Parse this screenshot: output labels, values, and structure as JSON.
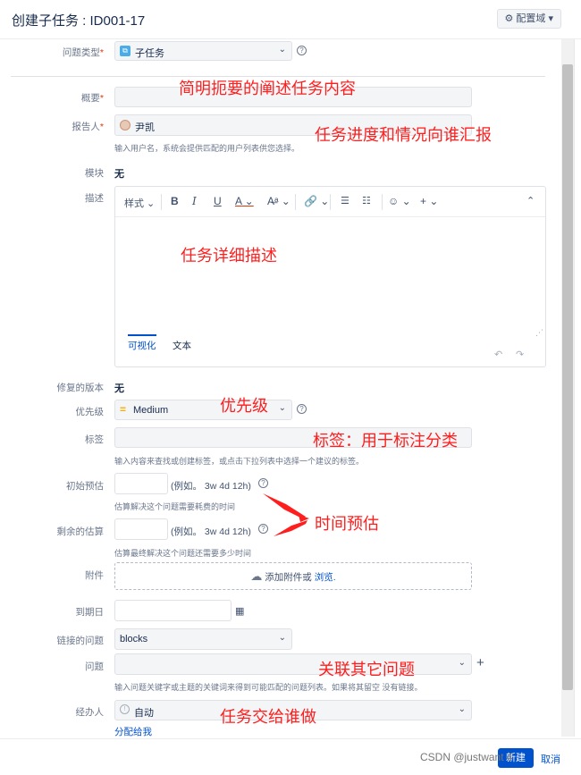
{
  "header": {
    "title": "创建子任务 : ID001-17",
    "config_label": "配置域"
  },
  "form": {
    "issue_type": {
      "label": "问题类型",
      "value": "子任务"
    },
    "summary": {
      "label": "概要",
      "value": ""
    },
    "reporter": {
      "label": "报告人",
      "value": "尹凯",
      "hint": "输入用户名，系统会提供匹配的用户列表供您选择。"
    },
    "module": {
      "label": "模块",
      "value": "无"
    },
    "description": {
      "label": "描述",
      "toolbar": {
        "style_label": "样式",
        "bold": "B",
        "italic": "I",
        "underline": "U",
        "text_color": "A"
      },
      "tabs": [
        "可视化",
        "文本"
      ]
    },
    "fix_version": {
      "label": "修复的版本",
      "value": "无"
    },
    "priority": {
      "label": "优先级",
      "value": "Medium"
    },
    "labels": {
      "label": "标签",
      "value": "",
      "hint": "输入内容来查找或创建标签，或点击下拉列表中选择一个建议的标签。"
    },
    "original_estimate": {
      "label": "初始预估",
      "example": "(例如。 3w 4d 12h)",
      "hint": "估算解决这个问题需要耗费的时间"
    },
    "remaining_estimate": {
      "label": "剩余的估算",
      "example": "(例如。 3w 4d 12h)",
      "hint": "估算最终解决这个问题还需要多少时间"
    },
    "attachment": {
      "label": "附件",
      "text": "添加附件或",
      "browse": "浏览."
    },
    "due_date": {
      "label": "到期日",
      "value": ""
    },
    "linked_issues": {
      "label": "链接的问题",
      "value": "blocks"
    },
    "issue": {
      "label": "问题",
      "value": "",
      "hint": "输入问题关键字或主题的关键词来得到可能匹配的问题列表。如果将其留空 没有链接。"
    },
    "assignee": {
      "label": "经办人",
      "value": "自动",
      "assign_to_me": "分配给我"
    }
  },
  "annotations": {
    "summary": "简明扼要的阐述任务内容",
    "reporter": "任务进度和情况向谁汇报",
    "description": "任务详细描述",
    "priority": "优先级",
    "labels": "标签：用于标注分类",
    "time": "时间预估",
    "linked": "关联其它问题",
    "assignee": "任务交给谁做"
  },
  "footer": {
    "watermark": "CSDN @justwant 4",
    "create_label": "新建",
    "cancel_label": "取消"
  },
  "colors": {
    "accent": "#0052cc",
    "annotation": "#ff1e1e",
    "priority": "#ffab00"
  }
}
